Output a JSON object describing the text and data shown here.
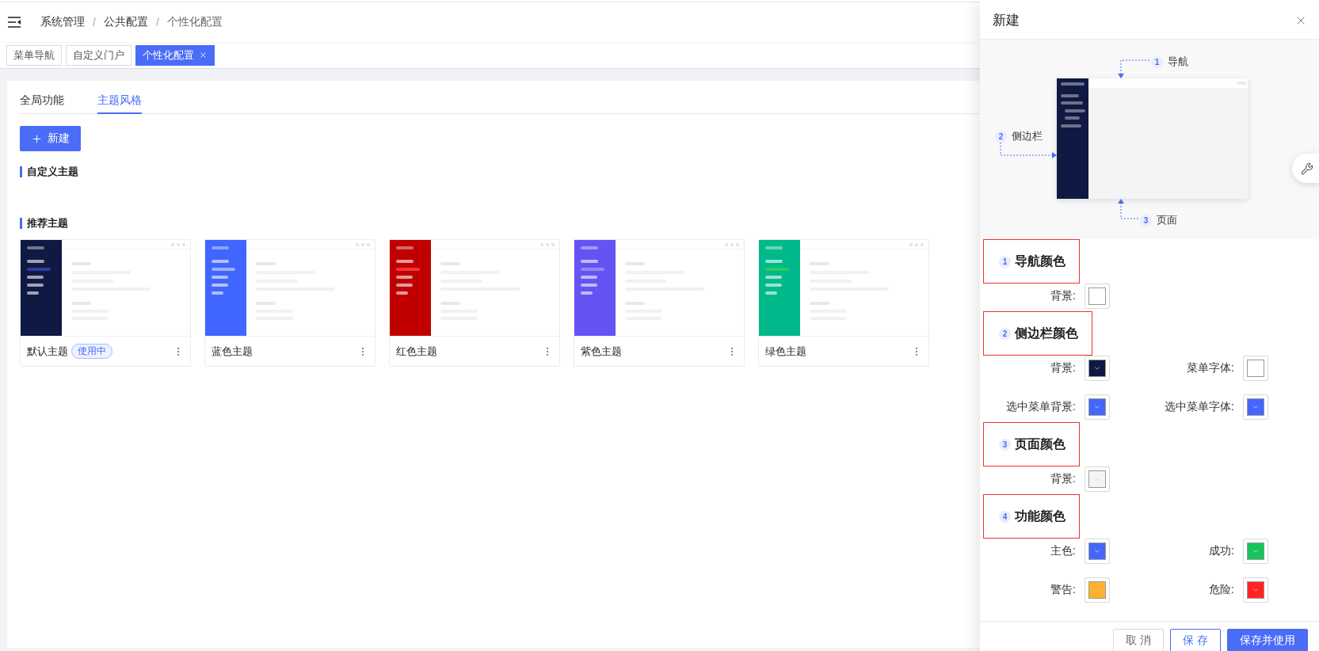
{
  "header": {
    "breadcrumb": [
      {
        "kind": "link",
        "text": "系统管理"
      },
      {
        "kind": "separator",
        "text": "/"
      },
      {
        "kind": "link",
        "text": "公共配置"
      },
      {
        "kind": "separator",
        "text": "/"
      },
      {
        "kind": "current",
        "text": "个性化配置"
      }
    ]
  },
  "page_tabs": [
    {
      "label": "菜单导航",
      "selected": false,
      "closable": false
    },
    {
      "label": "自定义门户",
      "selected": false,
      "closable": false
    },
    {
      "label": "个性化配置",
      "selected": true,
      "closable": true
    }
  ],
  "content": {
    "tabs": [
      {
        "label": "全局功能",
        "selected": false
      },
      {
        "label": "主题风格",
        "selected": true
      }
    ],
    "new_button": {
      "label": "新建"
    },
    "custom_themes": {
      "title": "自定义主题"
    },
    "recommended_themes": {
      "title": "推荐主题",
      "themes": [
        {
          "name": "默认主题",
          "badge": "使用中",
          "color": "#0f1943",
          "menu_highlight": {
            "color": "#2a3f9f"
          }
        },
        {
          "name": "蓝色主题",
          "color": "#4066ff",
          "menu_highlight": {
            "color": "#9db0ff"
          }
        },
        {
          "name": "红色主题",
          "color": "#c00000",
          "menu_highlight": {
            "color": "#ff3333"
          }
        },
        {
          "name": "紫色主题",
          "color": "#6554f4",
          "menu_highlight": {
            "color": "#9488f8"
          }
        },
        {
          "name": "绿色主题",
          "color": "#00b98a",
          "menu_highlight": {
            "color": "#2bcc5b"
          }
        }
      ]
    }
  },
  "drawer": {
    "title": "新建",
    "diagram": {
      "callouts": [
        {
          "kind": "nav",
          "number": "1",
          "label": "导航"
        },
        {
          "kind": "sidebar",
          "number": "2",
          "label": "侧边栏"
        },
        {
          "kind": "page",
          "number": "3",
          "label": "页面"
        }
      ]
    },
    "sections": [
      {
        "number": "1",
        "title": "导航颜色",
        "highlighted": true,
        "fields": [
          {
            "label": "背景:",
            "color": "#ffffff"
          }
        ]
      },
      {
        "number": "2",
        "title": "侧边栏颜色",
        "highlighted": true,
        "fields": [
          {
            "label": "背景:",
            "color": "#0f1943"
          },
          {
            "label": "菜单字体:",
            "color": "#ffffff"
          },
          {
            "label": "选中菜单背景:",
            "color": "#4466ff"
          },
          {
            "label": "选中菜单字体:",
            "color": "#4466ff"
          }
        ]
      },
      {
        "number": "3",
        "title": "页面颜色",
        "highlighted": true,
        "fields": [
          {
            "label": "背景:",
            "color": "#f4f4f5"
          }
        ]
      },
      {
        "number": "4",
        "title": "功能颜色",
        "highlighted": true,
        "fields": [
          {
            "label": "主色:",
            "color": "#4466ff"
          },
          {
            "label": "成功:",
            "color": "#16c55c"
          },
          {
            "label": "警告:",
            "color": "#ffb02e"
          },
          {
            "label": "危险:",
            "color": "#ff2323"
          }
        ]
      }
    ],
    "buttons": [
      {
        "kind": "default",
        "label": "取 消"
      },
      {
        "kind": "outline",
        "label": "保 存"
      },
      {
        "kind": "primary",
        "label": "保存并使用"
      }
    ]
  }
}
